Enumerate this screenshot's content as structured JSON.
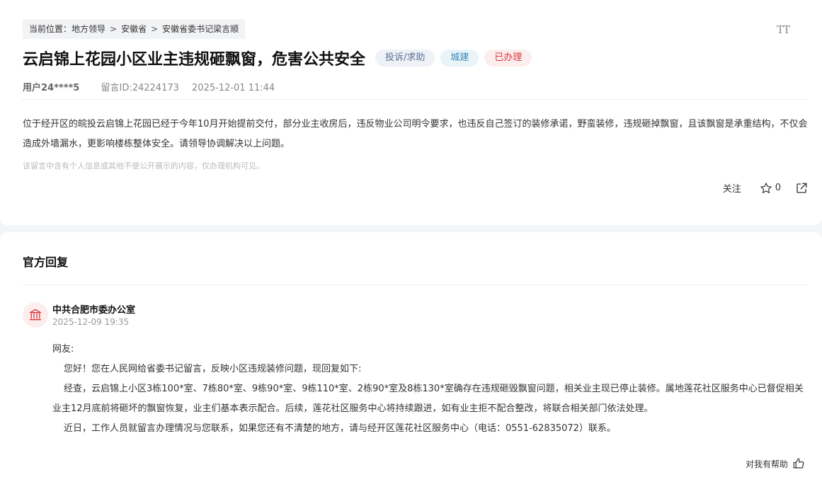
{
  "breadcrumb": {
    "prefix": "当前位置：",
    "items": [
      "地方领导",
      "安徽省",
      "安徽省委书记梁言顺"
    ],
    "separator": ">"
  },
  "font_size_icon": "TT",
  "post": {
    "title": "云启锦上花园小区业主违规砸飘窗，危害公共安全",
    "tags": {
      "type": "投诉/求助",
      "category": "城建",
      "status": "已办理"
    },
    "user": "用户24****5",
    "message_id": "留言ID:24224173",
    "datetime": "2025-12-01 11:44",
    "content": "位于经开区的皖投云启锦上花园已经于今年10月开始提前交付，部分业主收房后，违反物业公司明令要求，也违反自己签订的装修承诺，野蛮装修，违规砸掉飘窗，且该飘窗是承重结构，不仅会造成外墙漏水，更影响楼栋整体安全。请领导协调解决以上问题。",
    "notice": "该留言中含有个人信息或其他不便公开展示的内容，仅办理机构可见。",
    "actions": {
      "follow_label": "关注",
      "star_count": "0"
    }
  },
  "reply": {
    "section_title": "官方回复",
    "org_name": "中共合肥市委办公室",
    "org_time": "2025-12-09 19:35",
    "greeting": "网友:",
    "paragraphs": [
      "您好！您在人民网给省委书记留言，反映小区违规装修问题，现回复如下:",
      "经查，云启锦上小区3栋100*室、7栋80*室、9栋90*室、9栋110*室、2栋90*室及8栋130*室确存在违规砸毁飘窗问题，相关业主现已停止装修。属地莲花社区服务中心已督促相关业主12月底前将砸坏的飘窗恢复，业主们基本表示配合。后续，莲花社区服务中心将持续跟进，如有业主拒不配合整改，将联合相关部门依法处理。",
      "近日，工作人员就留言办理情况与您联系，如果您还有不清楚的地方，请与经开区莲花社区服务中心（电话：0551-62835072）联系。"
    ],
    "helpful_label": "对我有帮助"
  },
  "colors": {
    "status_red": "#d9363e",
    "category_blue": "#3a86b8",
    "type_slate": "#5a6e94"
  },
  "icons": [
    "font-size-icon",
    "star-icon",
    "share-icon",
    "government-building-icon",
    "thumbs-up-icon"
  ]
}
